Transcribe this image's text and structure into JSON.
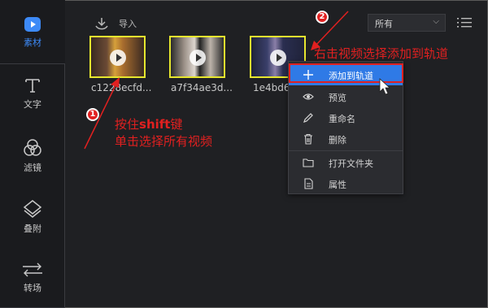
{
  "sidebar": {
    "items": [
      {
        "label": "素材",
        "icon": "play-icon"
      },
      {
        "label": "文字",
        "icon": "text-icon"
      },
      {
        "label": "滤镜",
        "icon": "filter-icon"
      },
      {
        "label": "叠附",
        "icon": "overlay-icon"
      },
      {
        "label": "转场",
        "icon": "transition-icon"
      }
    ]
  },
  "toolbar": {
    "import_label": "导入",
    "filter_value": "所有"
  },
  "media": [
    {
      "label": "c1228ecfd..."
    },
    {
      "label": "a7f34ae3d..."
    },
    {
      "label": "1e4bd6"
    }
  ],
  "context_menu": {
    "items": [
      {
        "label": "添加到轨道",
        "icon": "plus-icon"
      },
      {
        "label": "预览",
        "icon": "eye-icon"
      },
      {
        "label": "重命名",
        "icon": "pencil-icon"
      },
      {
        "label": "删除",
        "icon": "trash-icon"
      },
      {
        "label": "打开文件夹",
        "icon": "folder-icon"
      },
      {
        "label": "属性",
        "icon": "properties-icon"
      }
    ]
  },
  "annotations": {
    "badge1": "1",
    "badge2": "2",
    "step2_text": "右击视频选择添加到轨道",
    "step1_line1_prefix": "按住",
    "step1_line1_key": "shift",
    "step1_line1_suffix": "键",
    "step1_line2": "单击选择所有视频",
    "color": "#e12020",
    "highlight_color": "#e6e62e"
  },
  "colors": {
    "accent": "#3d8af7",
    "menu_highlight": "#2f7ae6",
    "background": "#1f2023"
  }
}
